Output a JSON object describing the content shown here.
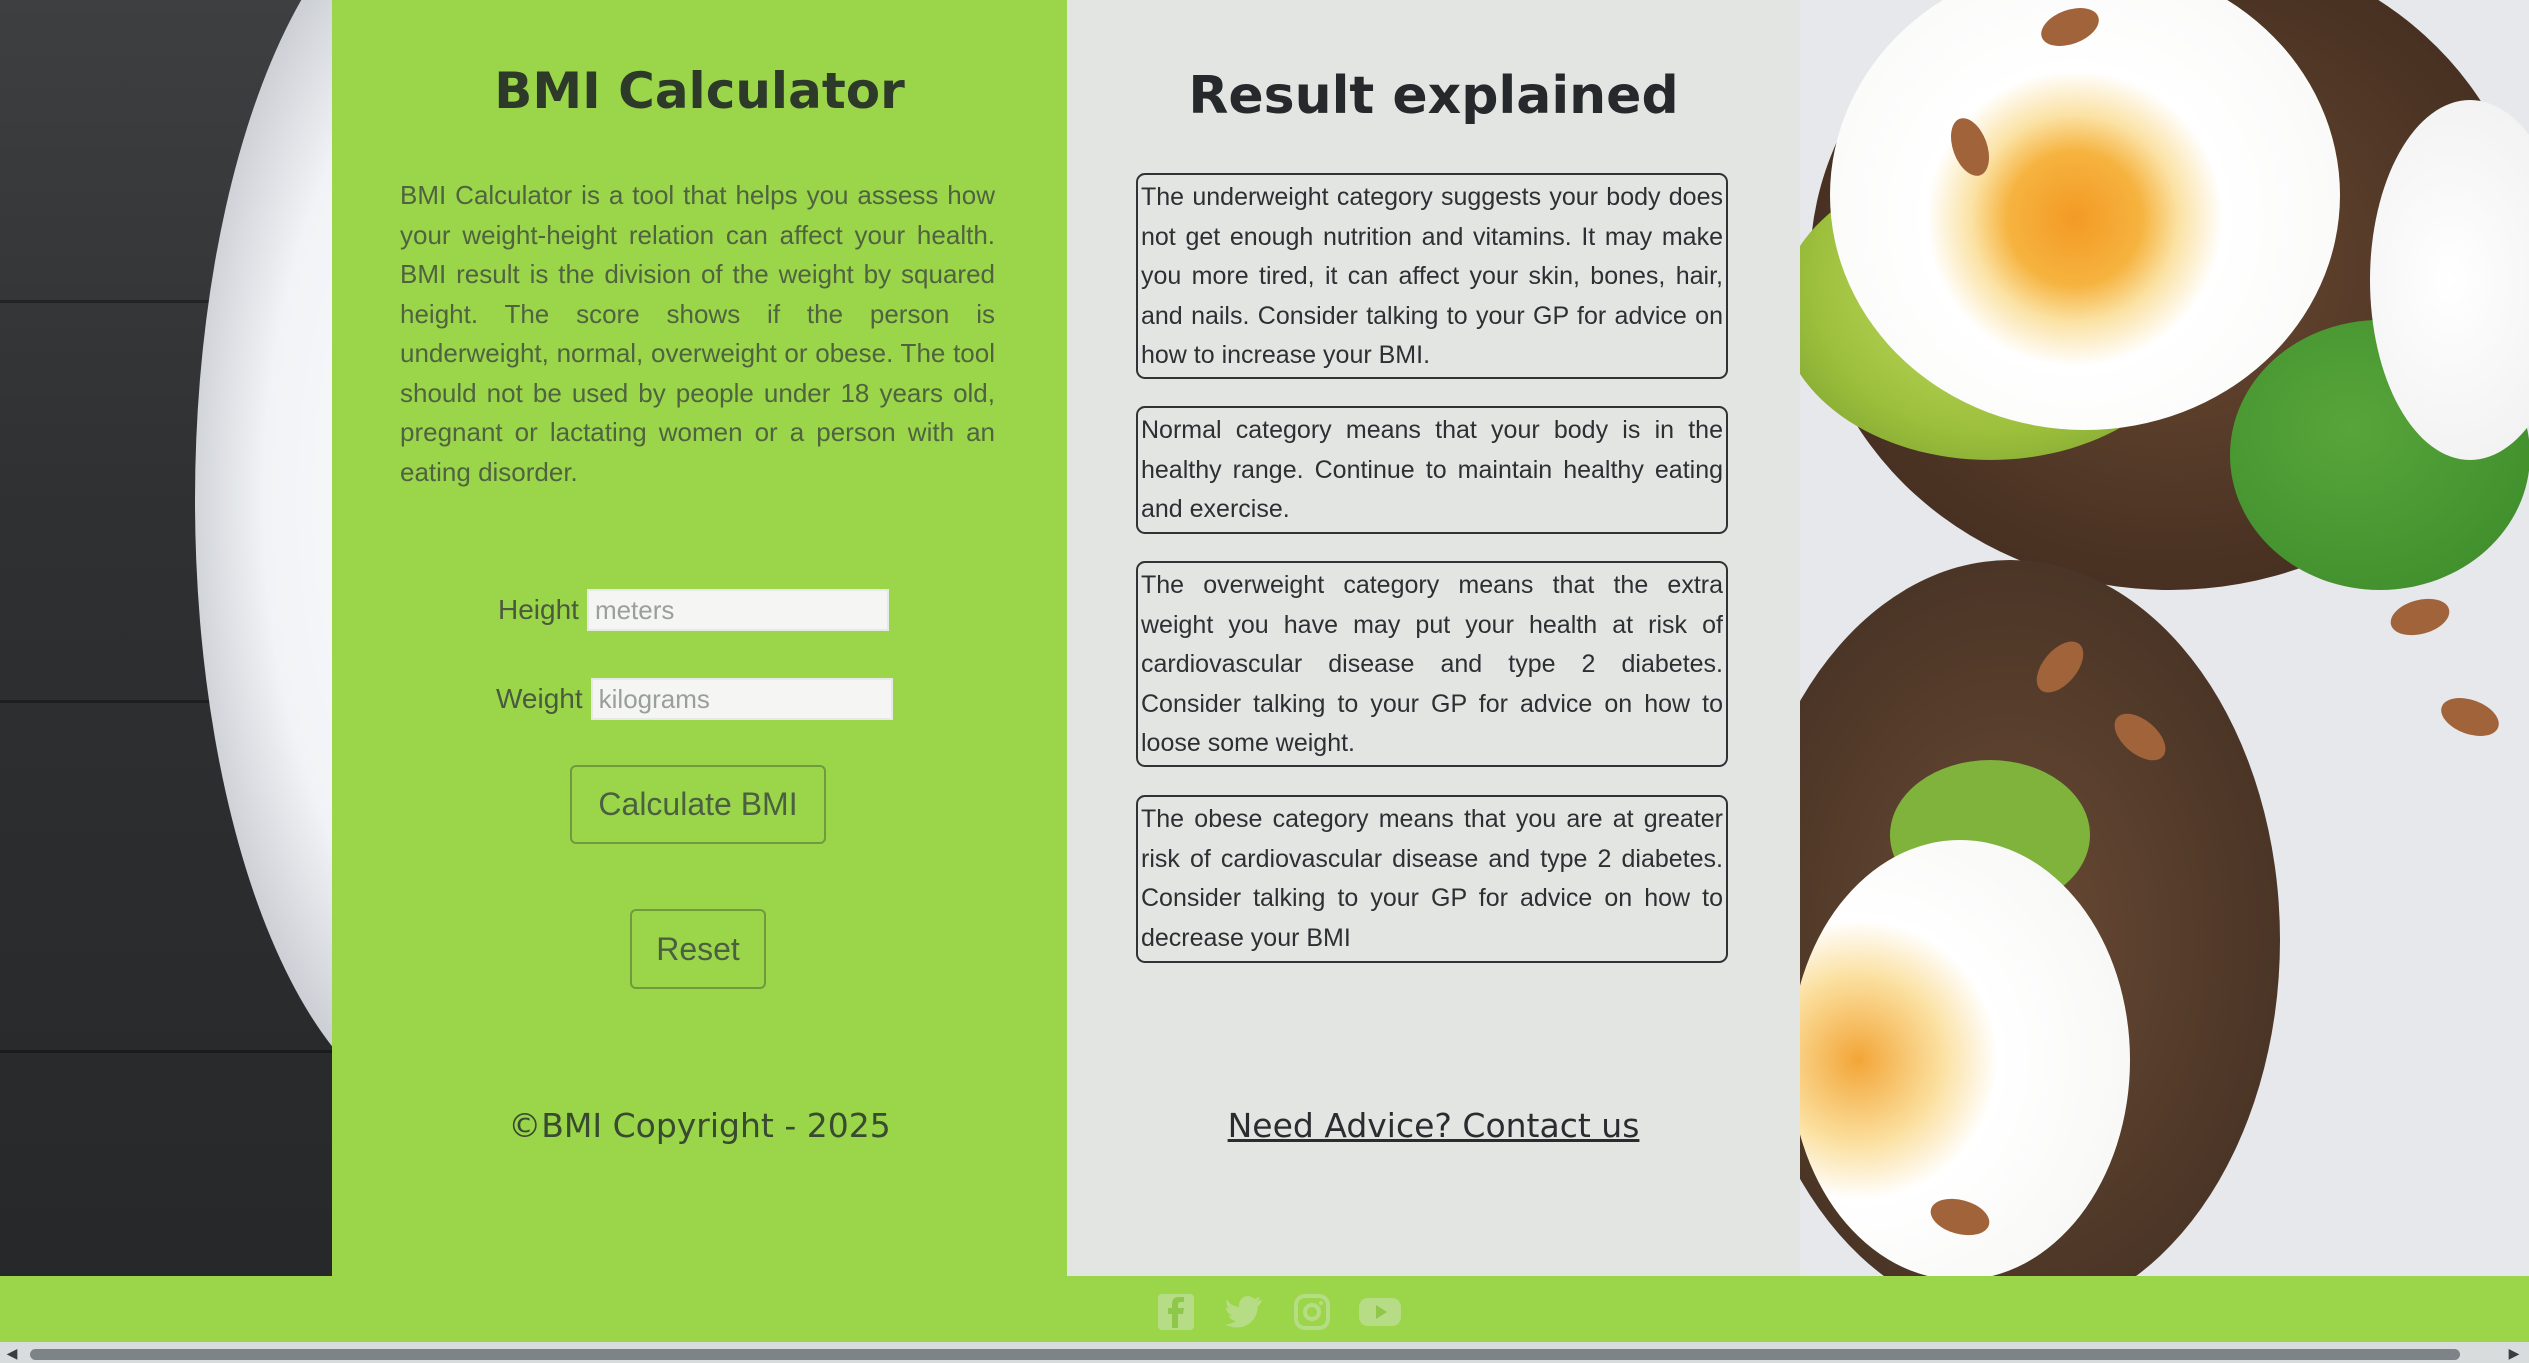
{
  "calculator": {
    "title": "BMI Calculator",
    "intro": "BMI Calculator is a tool that helps you assess how your weight-height relation can affect your health. BMI result is the division of the weight by squared height. The score shows if the person is underweight, normal, overweight or obese. The tool should not be used by people under 18 years old, pregnant or lactating women or a person with an eating disorder.",
    "height_label": "Height",
    "height_placeholder": "meters",
    "height_value": "",
    "weight_label": "Weight",
    "weight_placeholder": "kilograms",
    "weight_value": "",
    "calculate_label": "Calculate BMI",
    "reset_label": "Reset",
    "copyright": "©BMI Copyright - 2025"
  },
  "results": {
    "title": "Result explained",
    "underweight": "The underweight category suggests your body does not get enough nutrition and vitamins. It may make you more tired, it can affect your skin, bones, hair, and nails. Consider talking to your GP for advice on how to increase your BMI.",
    "normal": "Normal category means that your body is in the healthy range. Continue to maintain healthy eating and exercise.",
    "overweight": "The overweight category means that the extra weight you have may put your health at risk of cardiovascular disease and type 2 diabetes. Consider talking to your GP for advice on how to loose some weight.",
    "obese": "The obese category means that you are at greater risk of cardiovascular disease and type 2 diabetes. Consider talking to your GP for advice on how to decrease your BMI",
    "contact": "Need Advice? Contact us"
  },
  "footer": {
    "social": [
      "facebook-icon",
      "twitter-icon",
      "instagram-icon",
      "youtube-icon"
    ]
  },
  "colors": {
    "brand_green": "#9bd64a",
    "panel_grey": "#e3e5e3",
    "text_dark": "#2d3a2a"
  }
}
